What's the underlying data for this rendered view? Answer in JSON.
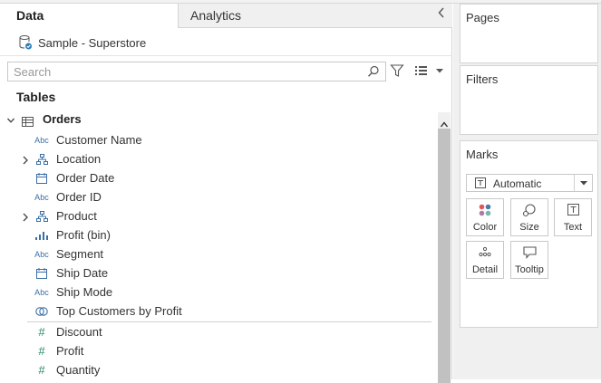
{
  "tabs": {
    "data": "Data",
    "analytics": "Analytics"
  },
  "datasource": {
    "name": "Sample - Superstore"
  },
  "search": {
    "placeholder": "Search",
    "value": ""
  },
  "tables_heading": "Tables",
  "table": {
    "name": "Orders",
    "fields": [
      {
        "label": "Customer Name",
        "icon": "abc-icon",
        "expandable": false
      },
      {
        "label": "Location",
        "icon": "hierarchy-icon",
        "expandable": true
      },
      {
        "label": "Order Date",
        "icon": "calendar-icon",
        "expandable": false
      },
      {
        "label": "Order ID",
        "icon": "abc-icon",
        "expandable": false
      },
      {
        "label": "Product",
        "icon": "hierarchy-icon",
        "expandable": true
      },
      {
        "label": "Profit (bin)",
        "icon": "bin-icon",
        "expandable": false
      },
      {
        "label": "Segment",
        "icon": "abc-icon",
        "expandable": false
      },
      {
        "label": "Ship Date",
        "icon": "calendar-icon",
        "expandable": false
      },
      {
        "label": "Ship Mode",
        "icon": "abc-icon",
        "expandable": false
      },
      {
        "label": "Top Customers by Profit",
        "icon": "set-icon",
        "expandable": false
      }
    ],
    "measures": [
      {
        "label": "Discount",
        "icon": "hash-icon"
      },
      {
        "label": "Profit",
        "icon": "hash-icon"
      },
      {
        "label": "Quantity",
        "icon": "hash-icon"
      }
    ]
  },
  "icons": {
    "abc_text": "Abc",
    "hash_text": "#",
    "text_mark": "T"
  },
  "cards": {
    "pages": "Pages",
    "filters": "Filters",
    "marks": "Marks"
  },
  "marks": {
    "type": "Automatic",
    "buttons": {
      "color": "Color",
      "size": "Size",
      "text": "Text",
      "detail": "Detail",
      "tooltip": "Tooltip"
    }
  },
  "colors": {
    "dimension": "#3a6ea5",
    "measure": "#2b8a67",
    "scrollbar": "#c1c1c1"
  }
}
